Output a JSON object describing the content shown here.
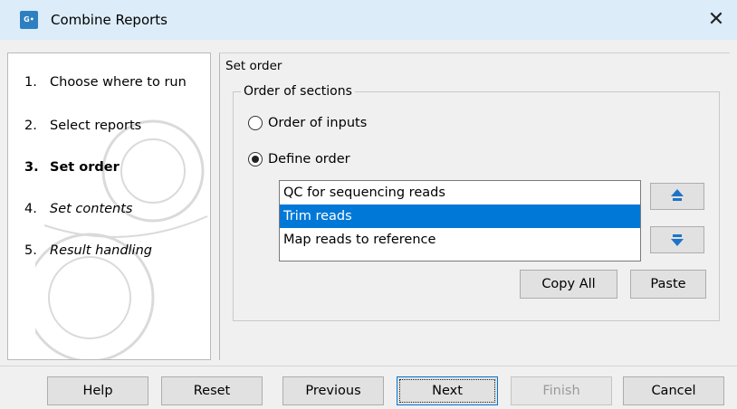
{
  "window": {
    "title": "Combine Reports",
    "app_icon_text": "G•",
    "close_glyph": "✕"
  },
  "wizard_steps": [
    {
      "number": "1.",
      "label": "Choose where to run",
      "state": "done"
    },
    {
      "number": "2.",
      "label": "Select reports",
      "state": "done"
    },
    {
      "number": "3.",
      "label": "Set order",
      "state": "current"
    },
    {
      "number": "4.",
      "label": "Set contents",
      "state": "future"
    },
    {
      "number": "5.",
      "label": "Result handling",
      "state": "future"
    }
  ],
  "panel": {
    "title": "Set order",
    "group_label": "Order of sections",
    "radio_order_of_inputs": "Order of inputs",
    "radio_define_order": "Define order",
    "selected_radio": "Define order",
    "list_items": [
      "QC for sequencing reads",
      "Trim reads",
      "Map reads to reference"
    ],
    "selected_item": "Trim reads",
    "move_up_icon": "arrow-up-icon",
    "move_down_icon": "arrow-down-icon",
    "copy_all_label": "Copy All",
    "paste_label": "Paste"
  },
  "footer": {
    "help": "Help",
    "reset": "Reset",
    "previous": "Previous",
    "next": "Next",
    "finish": "Finish",
    "cancel": "Cancel"
  },
  "colors": {
    "titlebar": "#dcecf9",
    "selection": "#0078d7",
    "arrow_icon": "#1e73c8"
  }
}
